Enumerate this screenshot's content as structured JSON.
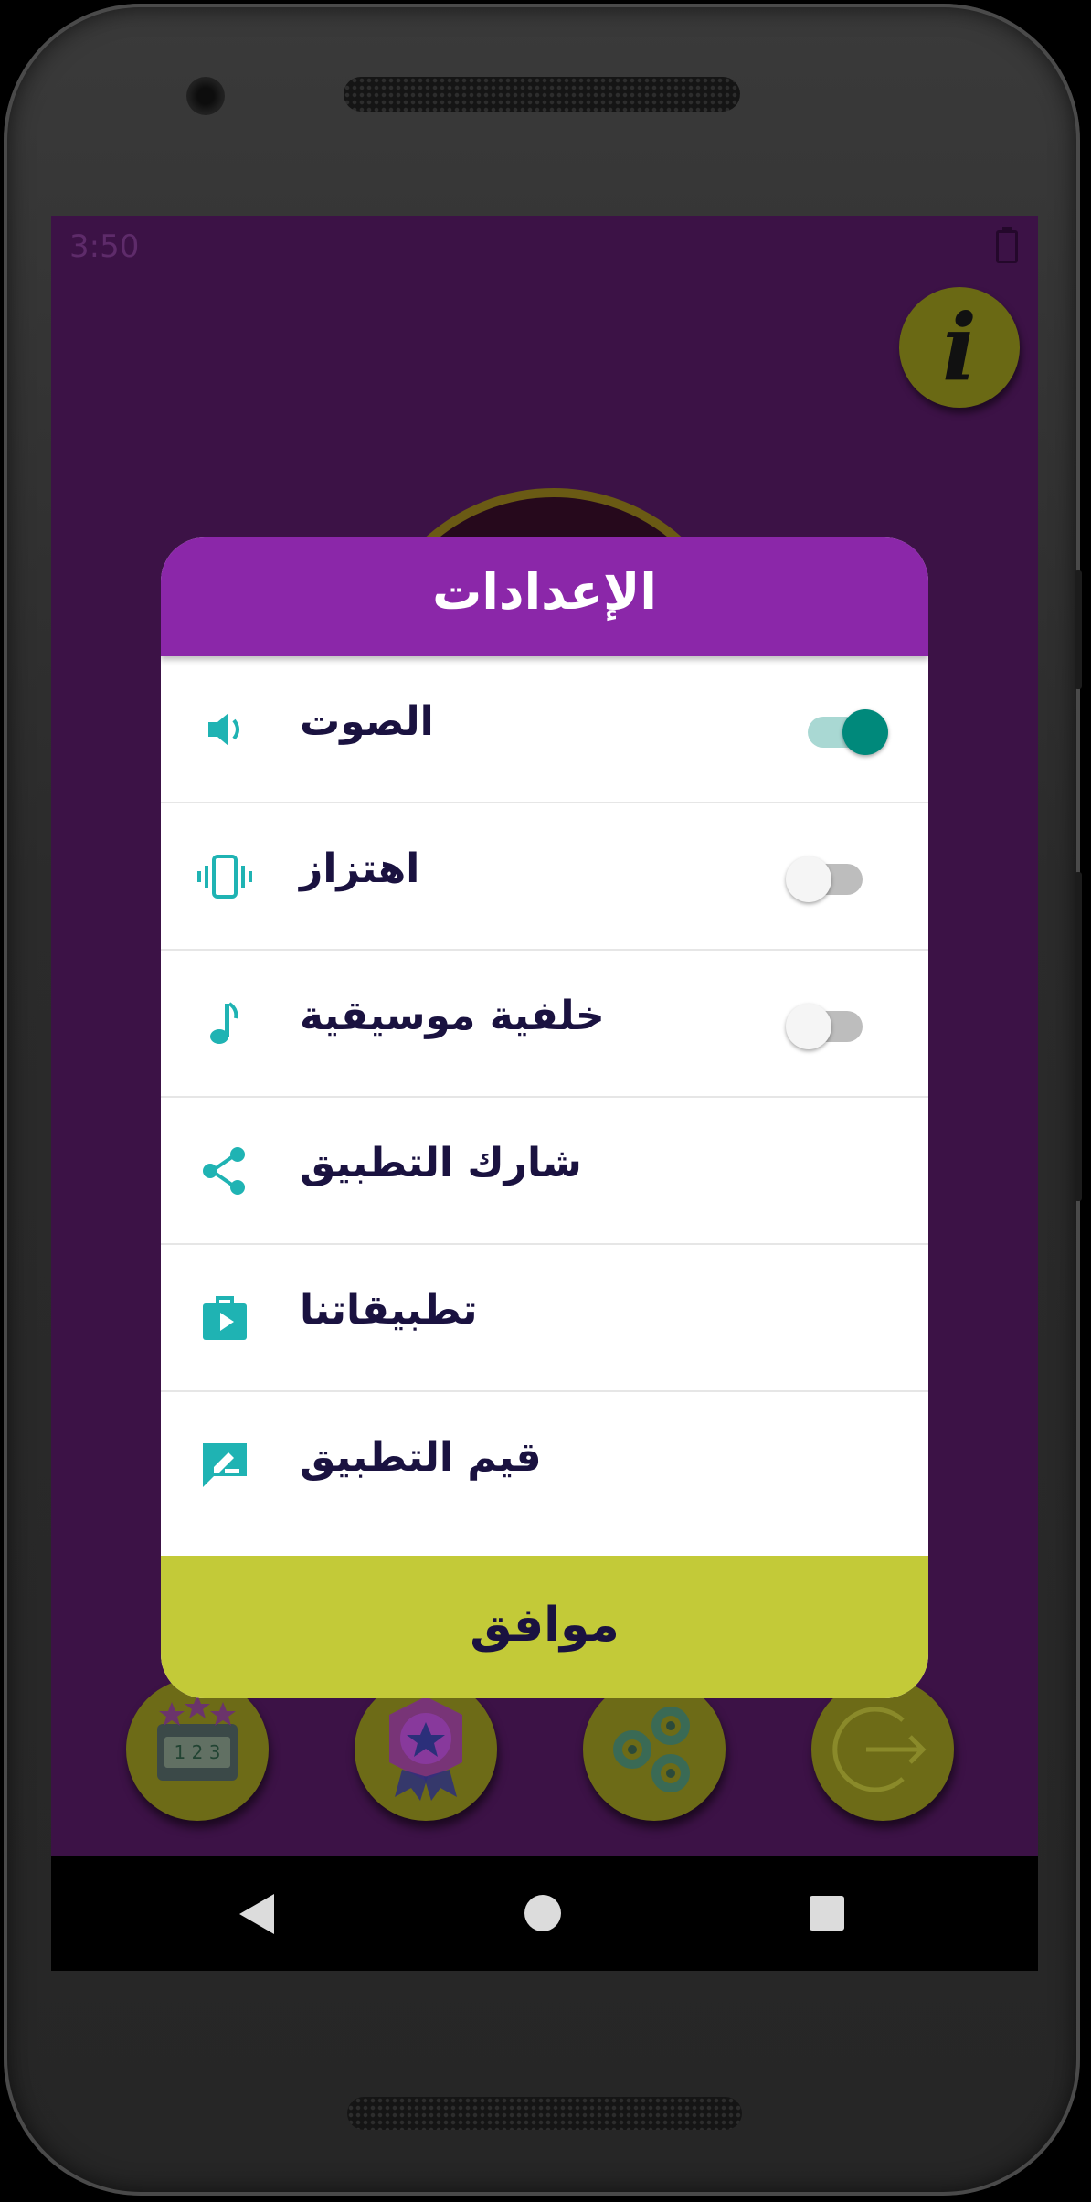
{
  "status_bar": {
    "time": "3:50"
  },
  "info_button": {
    "glyph": "i"
  },
  "dialog": {
    "title": "الإعدادات",
    "items": [
      {
        "label": "الصوت",
        "icon": "speaker-icon",
        "toggle": true,
        "toggle_on": true
      },
      {
        "label": "اهتزاز",
        "icon": "vibration-icon",
        "toggle": true,
        "toggle_on": false
      },
      {
        "label": "خلفية موسيقية",
        "icon": "music-note-icon",
        "toggle": true,
        "toggle_on": false
      },
      {
        "label": "شارك التطبيق",
        "icon": "share-icon",
        "toggle": false
      },
      {
        "label": "تطبيقاتنا",
        "icon": "store-bag-icon",
        "toggle": false
      },
      {
        "label": "قيم التطبيق",
        "icon": "rate-review-icon",
        "toggle": false
      }
    ],
    "ok_label": "موافق"
  },
  "bottom_buttons": [
    {
      "icon": "scoreboard-icon"
    },
    {
      "icon": "achievement-badge-icon"
    },
    {
      "icon": "settings-gears-icon"
    },
    {
      "icon": "exit-icon"
    }
  ],
  "colors": {
    "screen_bg": "#3c1246",
    "dialog_header": "#8b27a9",
    "ok_button": "#c3ca38",
    "icon_accent": "#1fb3b3",
    "toggle_on": "#00897b",
    "label_text": "#1a1240"
  }
}
